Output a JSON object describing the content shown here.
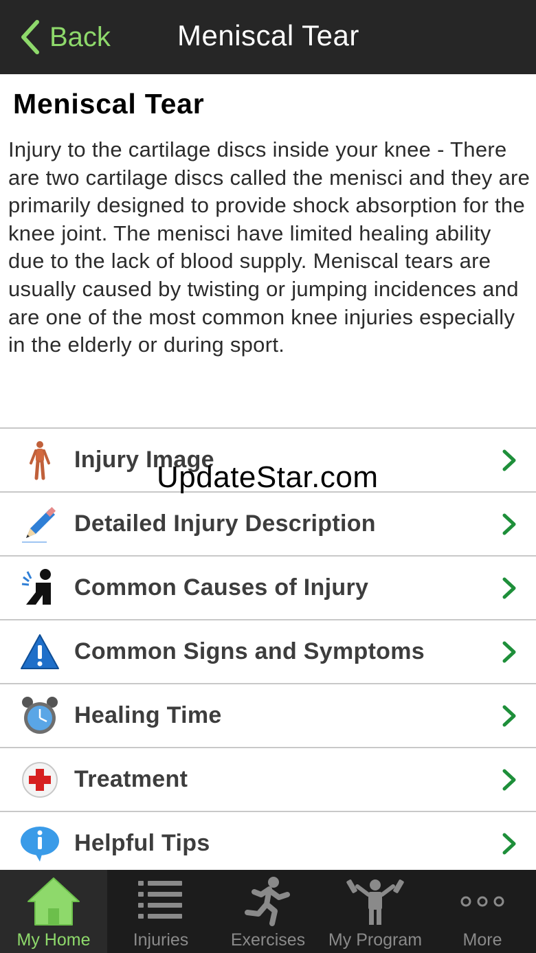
{
  "nav": {
    "back_label": "Back",
    "title": "Meniscal Tear"
  },
  "content": {
    "title": "Meniscal Tear",
    "description": "Injury to the cartilage discs inside your knee - There are two cartilage discs called the menisci and they are primarily designed to provide shock absorption for the knee joint. The menisci have limited healing ability due to the lack of blood supply. Meniscal tears are usually caused by twisting or jumping incidences and are one of the most common knee injuries especially in the elderly or during sport."
  },
  "menu": [
    {
      "label": "Injury Image",
      "icon": "body-anatomy-icon"
    },
    {
      "label": "Detailed Injury Description",
      "icon": "pencil-icon"
    },
    {
      "label": "Common Causes of Injury",
      "icon": "impact-person-icon"
    },
    {
      "label": "Common Signs and Symptoms",
      "icon": "warning-icon"
    },
    {
      "label": "Healing Time",
      "icon": "alarm-clock-icon"
    },
    {
      "label": "Treatment",
      "icon": "red-cross-icon"
    },
    {
      "label": "Helpful Tips",
      "icon": "info-bubble-icon"
    }
  ],
  "watermark": "UpdateStar.com",
  "tabs": [
    {
      "label": "My Home",
      "icon": "home-icon",
      "active": true
    },
    {
      "label": "Injuries",
      "icon": "list-icon",
      "active": false
    },
    {
      "label": "Exercises",
      "icon": "running-icon",
      "active": false
    },
    {
      "label": "My Program",
      "icon": "weightlifter-icon",
      "active": false
    },
    {
      "label": "More",
      "icon": "more-dots-icon",
      "active": false
    }
  ],
  "colors": {
    "accent_green": "#8ed96b",
    "chevron_green": "#1e8f3a",
    "navbar_bg": "#262626",
    "tabbar_bg": "#1c1c1c"
  }
}
